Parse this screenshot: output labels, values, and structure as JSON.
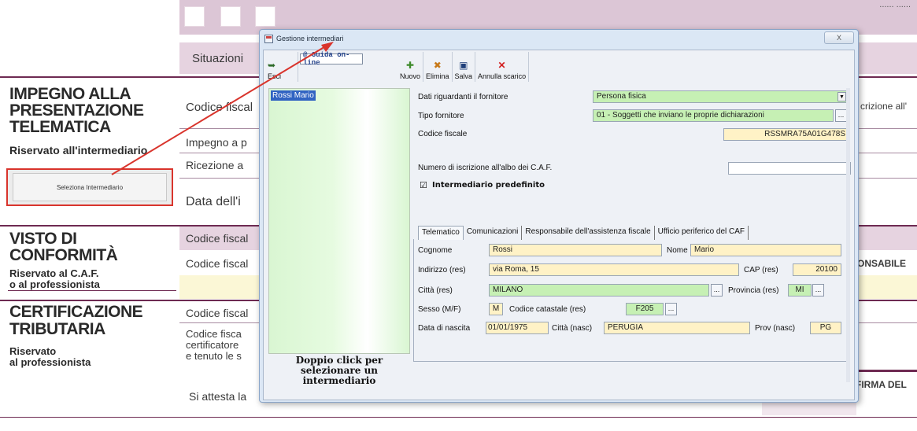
{
  "background": {
    "top_right_text": "...... ......",
    "sections": {
      "impegno_title_1": "IMPEGNO ALLA",
      "impegno_title_2": "PRESENTAZIONE",
      "impegno_title_3": "TELEMATICA",
      "impegno_sub": "Riservato all'intermediario",
      "visto_title_1": "VISTO DI",
      "visto_title_2": "CONFORMITÀ",
      "visto_sub_1": "Riservato al C.A.F.",
      "visto_sub_2": "o al professionista",
      "cert_title_1": "CERTIFICAZIONE",
      "cert_title_2": "TRIBUTARIA",
      "cert_sub_1": "Riservato",
      "cert_sub_2": "al professionista"
    },
    "select_button": "Seleziona Intermediario",
    "fields": {
      "situazioni": "Situazioni",
      "codice_fiscale_1": "Codice fiscal",
      "impegno": "Impegno a p",
      "ricezione": "Ricezione a",
      "data": "Data dell'i",
      "codice_fiscale_2": "Codice fiscal",
      "codice_fiscale_3": "Codice fiscal",
      "codice_fiscale_4": "Codice fiscal",
      "codice_fiscale_5": "Codice fisca",
      "certificatore": "certificatore",
      "tenuto": "e tenuto le s",
      "si_attesta": "Si attesta la",
      "si_attesta_tail": "....................................",
      "iscrizione": "crizione all'",
      "responsabile": "ONSABILE",
      "firma": "FIRMA DEL"
    }
  },
  "dialog": {
    "title": "Gestione intermediari",
    "close_label": "X",
    "guida_label": "@ Guida on-line",
    "toolbar": {
      "esci": "Esci",
      "nuovo": "Nuovo",
      "elimina": "Elimina",
      "salva": "Salva",
      "annulla": "Annulla scarico"
    },
    "list_items": [
      "Rossi Mario"
    ],
    "hint": "Doppio click per selezionare un intermediario",
    "form": {
      "dati_label": "Dati riguardanti il fornitore",
      "dati_value": "Persona fisica",
      "tipo_label": "Tipo fornitore",
      "tipo_value": "01 - Soggetti che inviano le proprie dichiarazioni",
      "cf_label": "Codice fiscale",
      "cf_value": "RSSMRA75A01G478S",
      "albo_label": "Numero di iscrizione all'albo dei C.A.F.",
      "albo_value": "",
      "predefinito_label": "Intermediario predefinito",
      "predefinito_checked": true
    },
    "tabs": [
      "Telematico",
      "Comunicazioni",
      "Responsabile dell'assistenza fiscale",
      "Ufficio periferico del CAF"
    ],
    "telematico": {
      "cognome_label": "Cognome",
      "cognome_value": "Rossi",
      "nome_label": "Nome",
      "nome_value": "Mario",
      "indirizzo_label": "Indirizzo (res)",
      "indirizzo_value": "via Roma, 15",
      "cap_label": "CAP (res)",
      "cap_value": "20100",
      "citta_label": "Città (res)",
      "citta_value": "MILANO",
      "provincia_label": "Provincia (res)",
      "provincia_value": "MI",
      "sesso_label": "Sesso (M/F)",
      "sesso_value": "M",
      "catastale_label": "Codice catastale (res)",
      "catastale_value": "F205",
      "nascita_label": "Data di nascita",
      "nascita_value": "01/01/1975",
      "citta_nasc_label": "Città (nasc)",
      "citta_nasc_value": "PERUGIA",
      "prov_nasc_label": "Prov (nasc)",
      "prov_nasc_value": "PG"
    },
    "ellipsis": "..."
  },
  "colors": {
    "accent_red": "#d9342c",
    "green_field": "#c6f0b4",
    "yellow_field": "#fff2c6",
    "form_band": "#e6d3e0",
    "rule": "#6e2a52"
  }
}
